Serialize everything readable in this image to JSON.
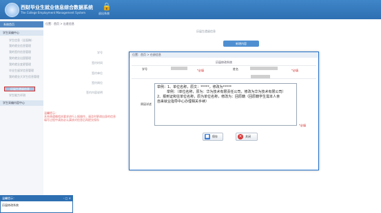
{
  "header": {
    "title": "西财毕业生就业信息综合数据系统",
    "subtitle": "The College Employment Management System",
    "lock_label": "退出系统"
  },
  "sidebar": {
    "home": "系统首页",
    "group1": "学生采编中心",
    "items": [
      "学生信息（全面稿）",
      "我的就业信息管理",
      "我的签约信息管理",
      "我的就业出国管理",
      "我的就业变更管理",
      "毕业生留学信息管理",
      "我的就业大学生信息管理",
      "历届生遗留信息",
      "学生能力评测",
      "其他签约"
    ],
    "active_item": "历届生遗留信息",
    "group2": "学生采编内容中心"
  },
  "background": {
    "breadcrumb": "位置：首页 > 出差信息",
    "panel_title": "历届生遗留信息",
    "action_button": "新增内容",
    "labels": [
      "学号",
      "签约时间",
      "签约单位",
      "签约岗位",
      "签约内容说明"
    ],
    "alert": "温馨提示：\n本系统遵循相关要求进行上报操作，请及时更改自身的信息\n填写过程中请务必认真核对信息后再提交保存"
  },
  "modal": {
    "breadcrumb": "位置：首页 > 在册信息",
    "title": "历届修改系统",
    "student_id_label": "学号",
    "name_label": "姓名",
    "remark_label": "原因详述",
    "required_mark": "*必填",
    "textarea_lines": [
      "举例：1、单位名称，原文：*****，修改为*****",
      "举例：（单位名称，原为：华为技术有限责任公司，修改为华为技术有限公司）",
      "2、报到证和往单位名称，原为单位名称，修改为：回原籍（回原籍学生需本人亲",
      "自来就业指导中心办理相关手续）"
    ],
    "save_label": "保存",
    "close_label": "关闭"
  },
  "notice": {
    "title": "温馨提示：",
    "controls": "- □ ×",
    "body": "历届修改系统"
  },
  "colors": {
    "header_blue": "#2e6fb2",
    "modal_border": "#1f6fcb",
    "highlight_red": "#d02a2a",
    "button_blue": "#4f8fd1"
  }
}
